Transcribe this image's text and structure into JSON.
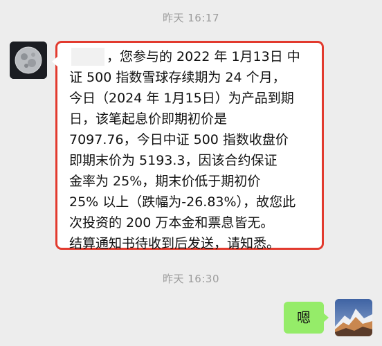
{
  "timestamps": [
    "昨天 16:17",
    "昨天 16:30"
  ],
  "contact_avatar": {
    "icon": "moon-avatar-icon"
  },
  "user_avatar": {
    "icon": "mountain-avatar-icon"
  },
  "incoming_message": {
    "lines": [
      "，您参与的 2022 年 1月13日 中",
      "证 500 指数雪球存续期为 24 个月，",
      "今日（2024 年 1月15日）为产品到期",
      "日，该笔起息价即期初价是",
      "7097.76，今日中证 500 指数收盘价",
      "即期末价为 5193.3，因该合约保证",
      "金率为 25%，期末价低于期初价",
      "25% 以上（跌幅为-26.83%），故您此",
      "次投资的 200 万本金和票息皆无。",
      "结算通知书待收到后发送，请知悉。"
    ],
    "highlight_color": "#e23a2e"
  },
  "outgoing_message": {
    "text": "嗯",
    "bubble_color": "#95ec69"
  }
}
